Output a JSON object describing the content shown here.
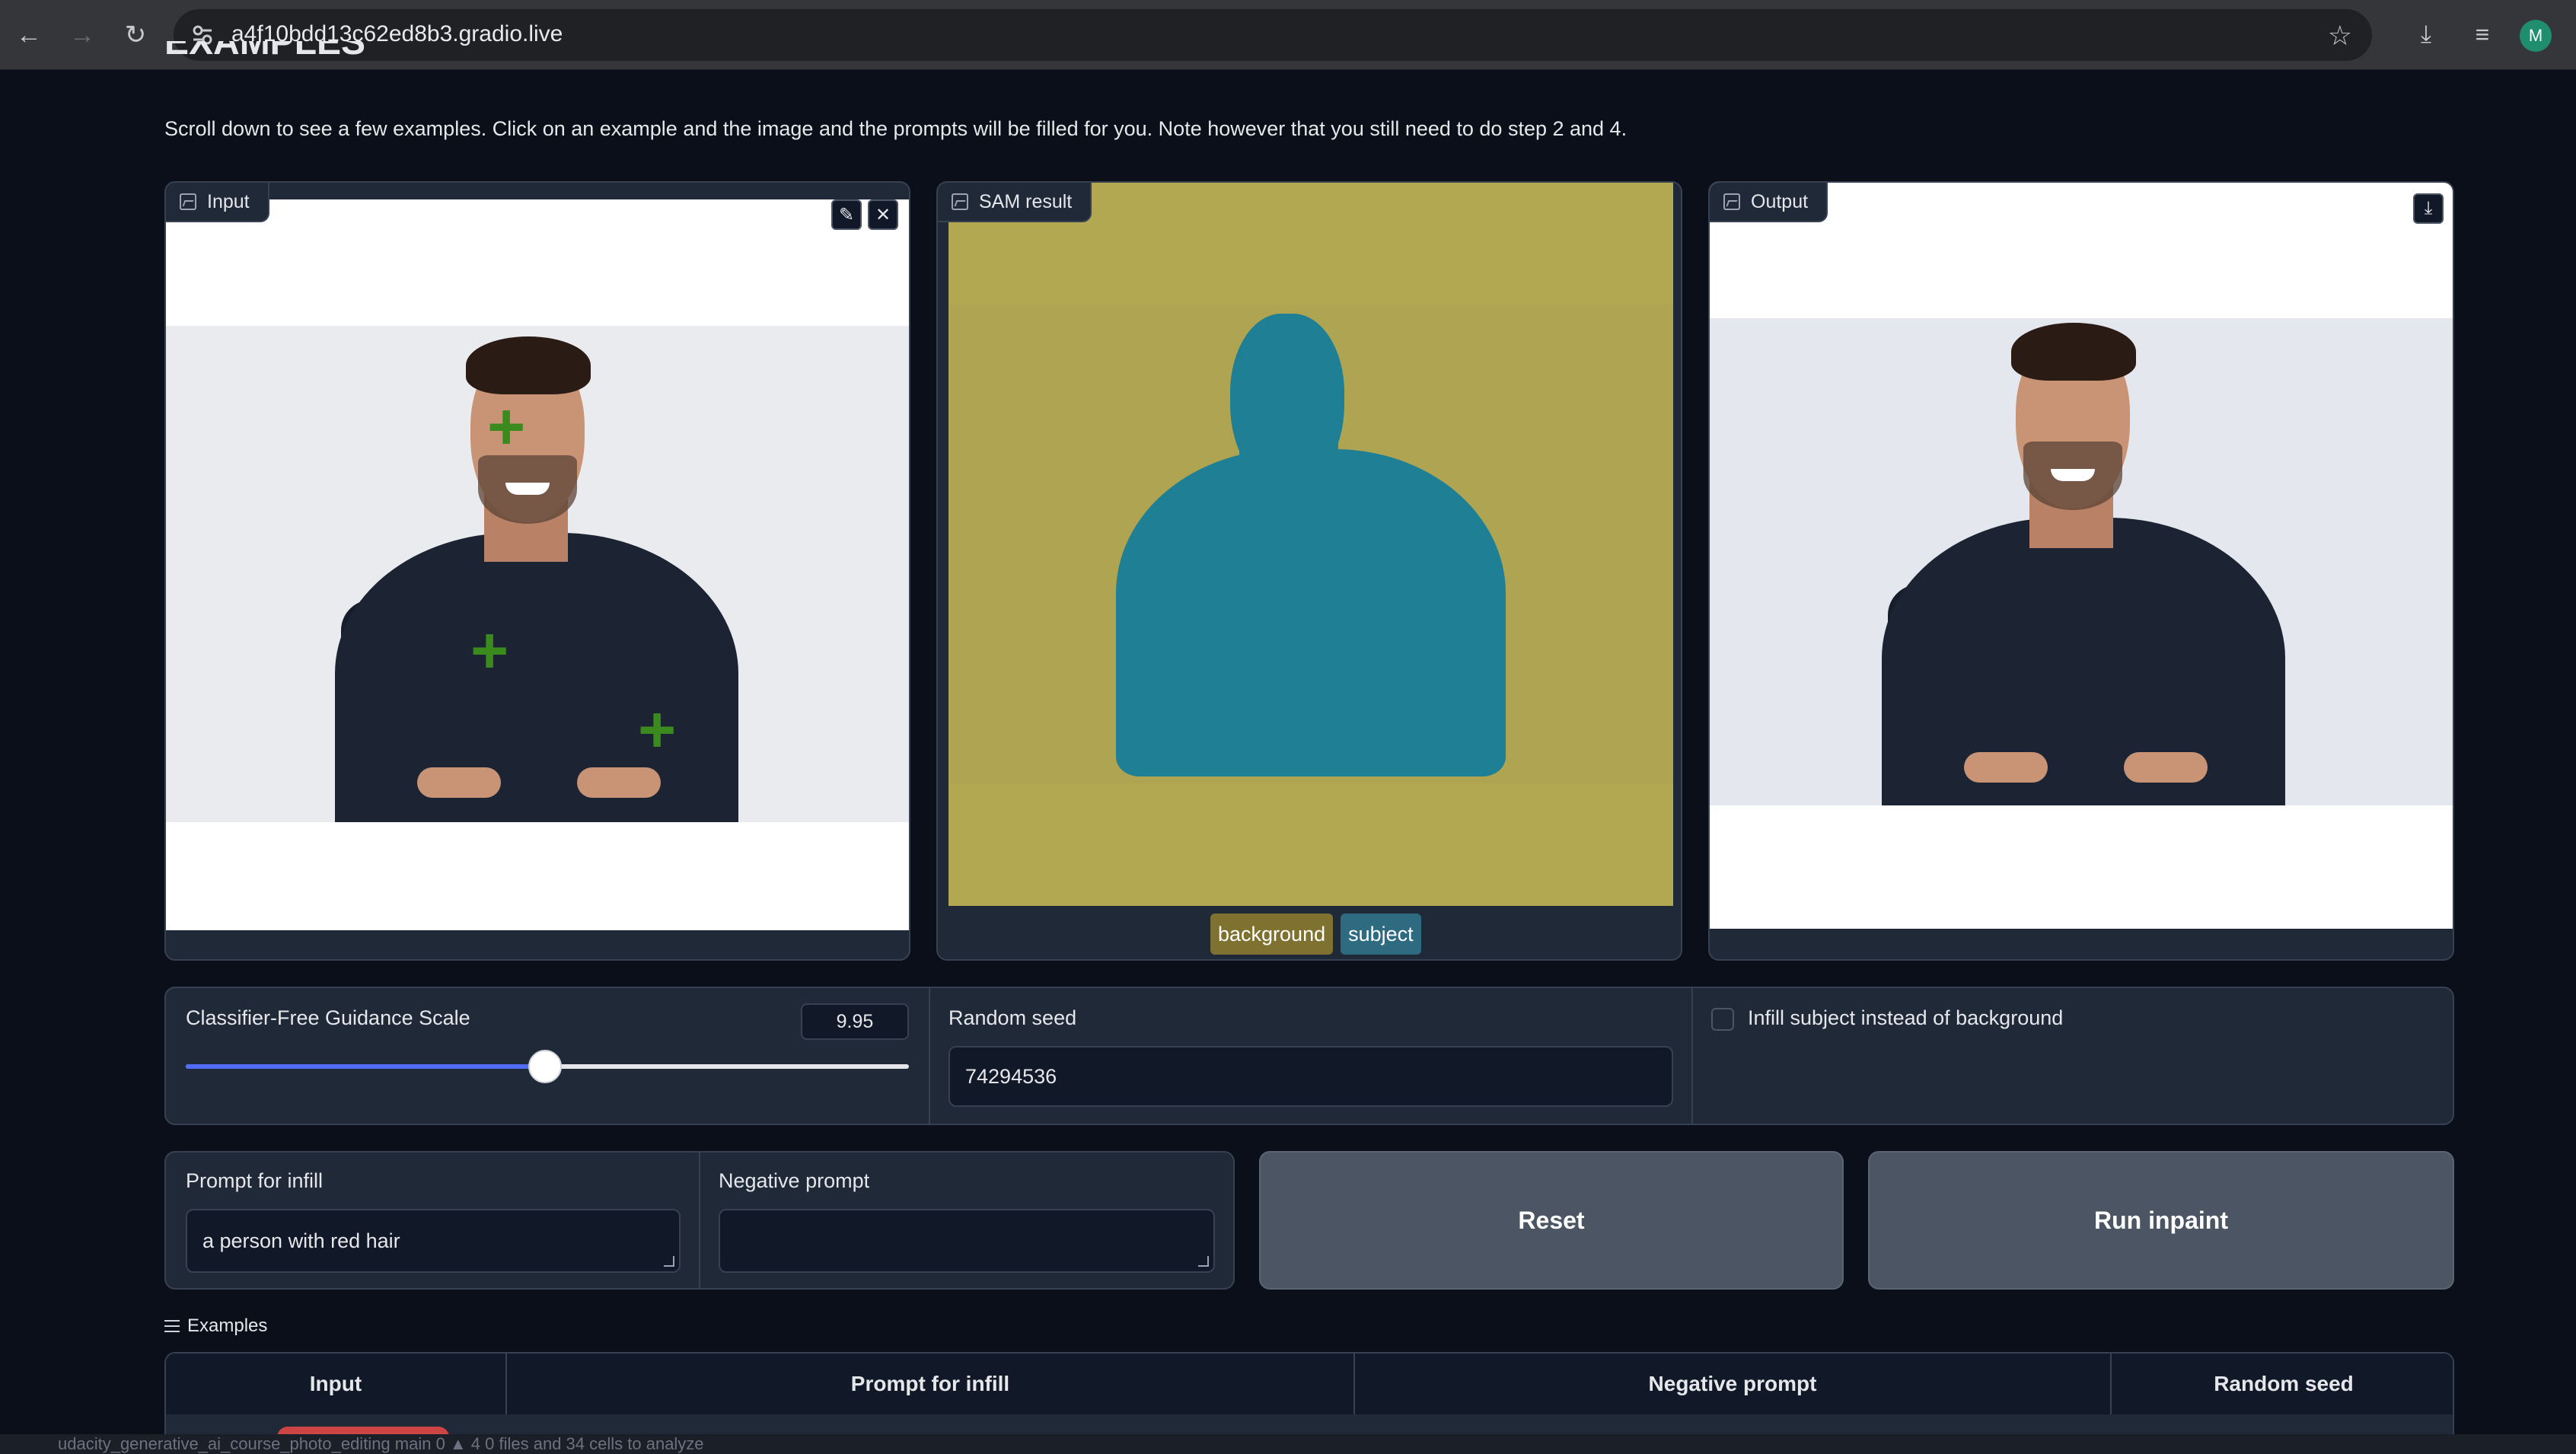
{
  "browser": {
    "url": "a4f10bdd13c62ed8b3.gradio.live",
    "profile_initial": "M"
  },
  "page": {
    "section_heading": "EXAMPLES",
    "intro": "Scroll down to see a few examples. Click on an example and the image and the prompts will be filled for you. Note however that you still need to do step 2 and 4."
  },
  "panels": {
    "input_label": "Input",
    "sam_label": "SAM result",
    "output_label": "Output",
    "legend": [
      "background",
      "subject"
    ],
    "colors": {
      "background": "#b3a852",
      "subject": "#1f7f95",
      "point": "#3a8a1e"
    }
  },
  "controls": {
    "cfg_label": "Classifier-Free Guidance Scale",
    "cfg_value": "9.95",
    "cfg_fraction": 0.497,
    "seed_label": "Random seed",
    "seed_value": "74294536",
    "infill_subject_label": "Infill subject instead of background",
    "infill_subject_checked": false
  },
  "prompts": {
    "infill_label": "Prompt for infill",
    "infill_value": "a person with red hair",
    "negative_label": "Negative prompt",
    "negative_value": ""
  },
  "buttons": {
    "reset": "Reset",
    "run": "Run inpaint"
  },
  "examples": {
    "title": "Examples",
    "columns": [
      "Input",
      "Prompt for infill",
      "Negative prompt",
      "Random seed"
    ]
  },
  "status_bar": "udacity_generative_ai_course_photo_editing  main  0 ▲ 4  0 files and 34 cells to analyze"
}
